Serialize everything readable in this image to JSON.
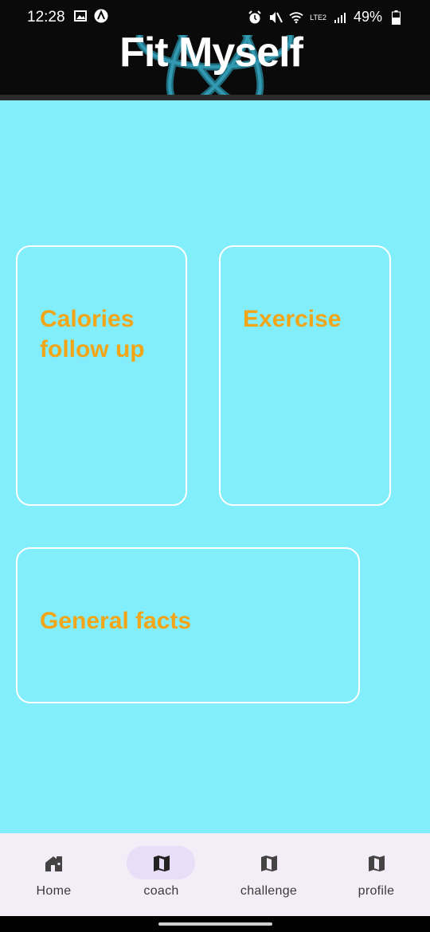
{
  "status_bar": {
    "time": "12:28",
    "battery_percent": "49%",
    "network_label": "LTE2",
    "icons": [
      "gallery-icon",
      "app-a-icon",
      "alarm-icon",
      "mute-icon",
      "wifi-icon",
      "signal-icon",
      "battery-icon"
    ]
  },
  "header": {
    "title": "Fit Myself",
    "logo_icon": "react-atom-icon",
    "logo_color": "#61dafb"
  },
  "cards": [
    {
      "label": "Calories follow up"
    },
    {
      "label": "Exercise"
    },
    {
      "label": "General facts"
    }
  ],
  "bottom_nav": {
    "items": [
      {
        "label": "Home",
        "icon": "home-icon",
        "active": false
      },
      {
        "label": "coach",
        "icon": "map-icon",
        "active": true
      },
      {
        "label": "challenge",
        "icon": "map-icon",
        "active": false
      },
      {
        "label": "profile",
        "icon": "map-icon",
        "active": false
      }
    ]
  },
  "colors": {
    "header_bg": "#0a0a0a",
    "content_bg": "#82edfb",
    "card_border": "#ffffff",
    "card_text": "#f2a516",
    "nav_bg": "#f2edf6",
    "nav_active": "#e8def8"
  }
}
